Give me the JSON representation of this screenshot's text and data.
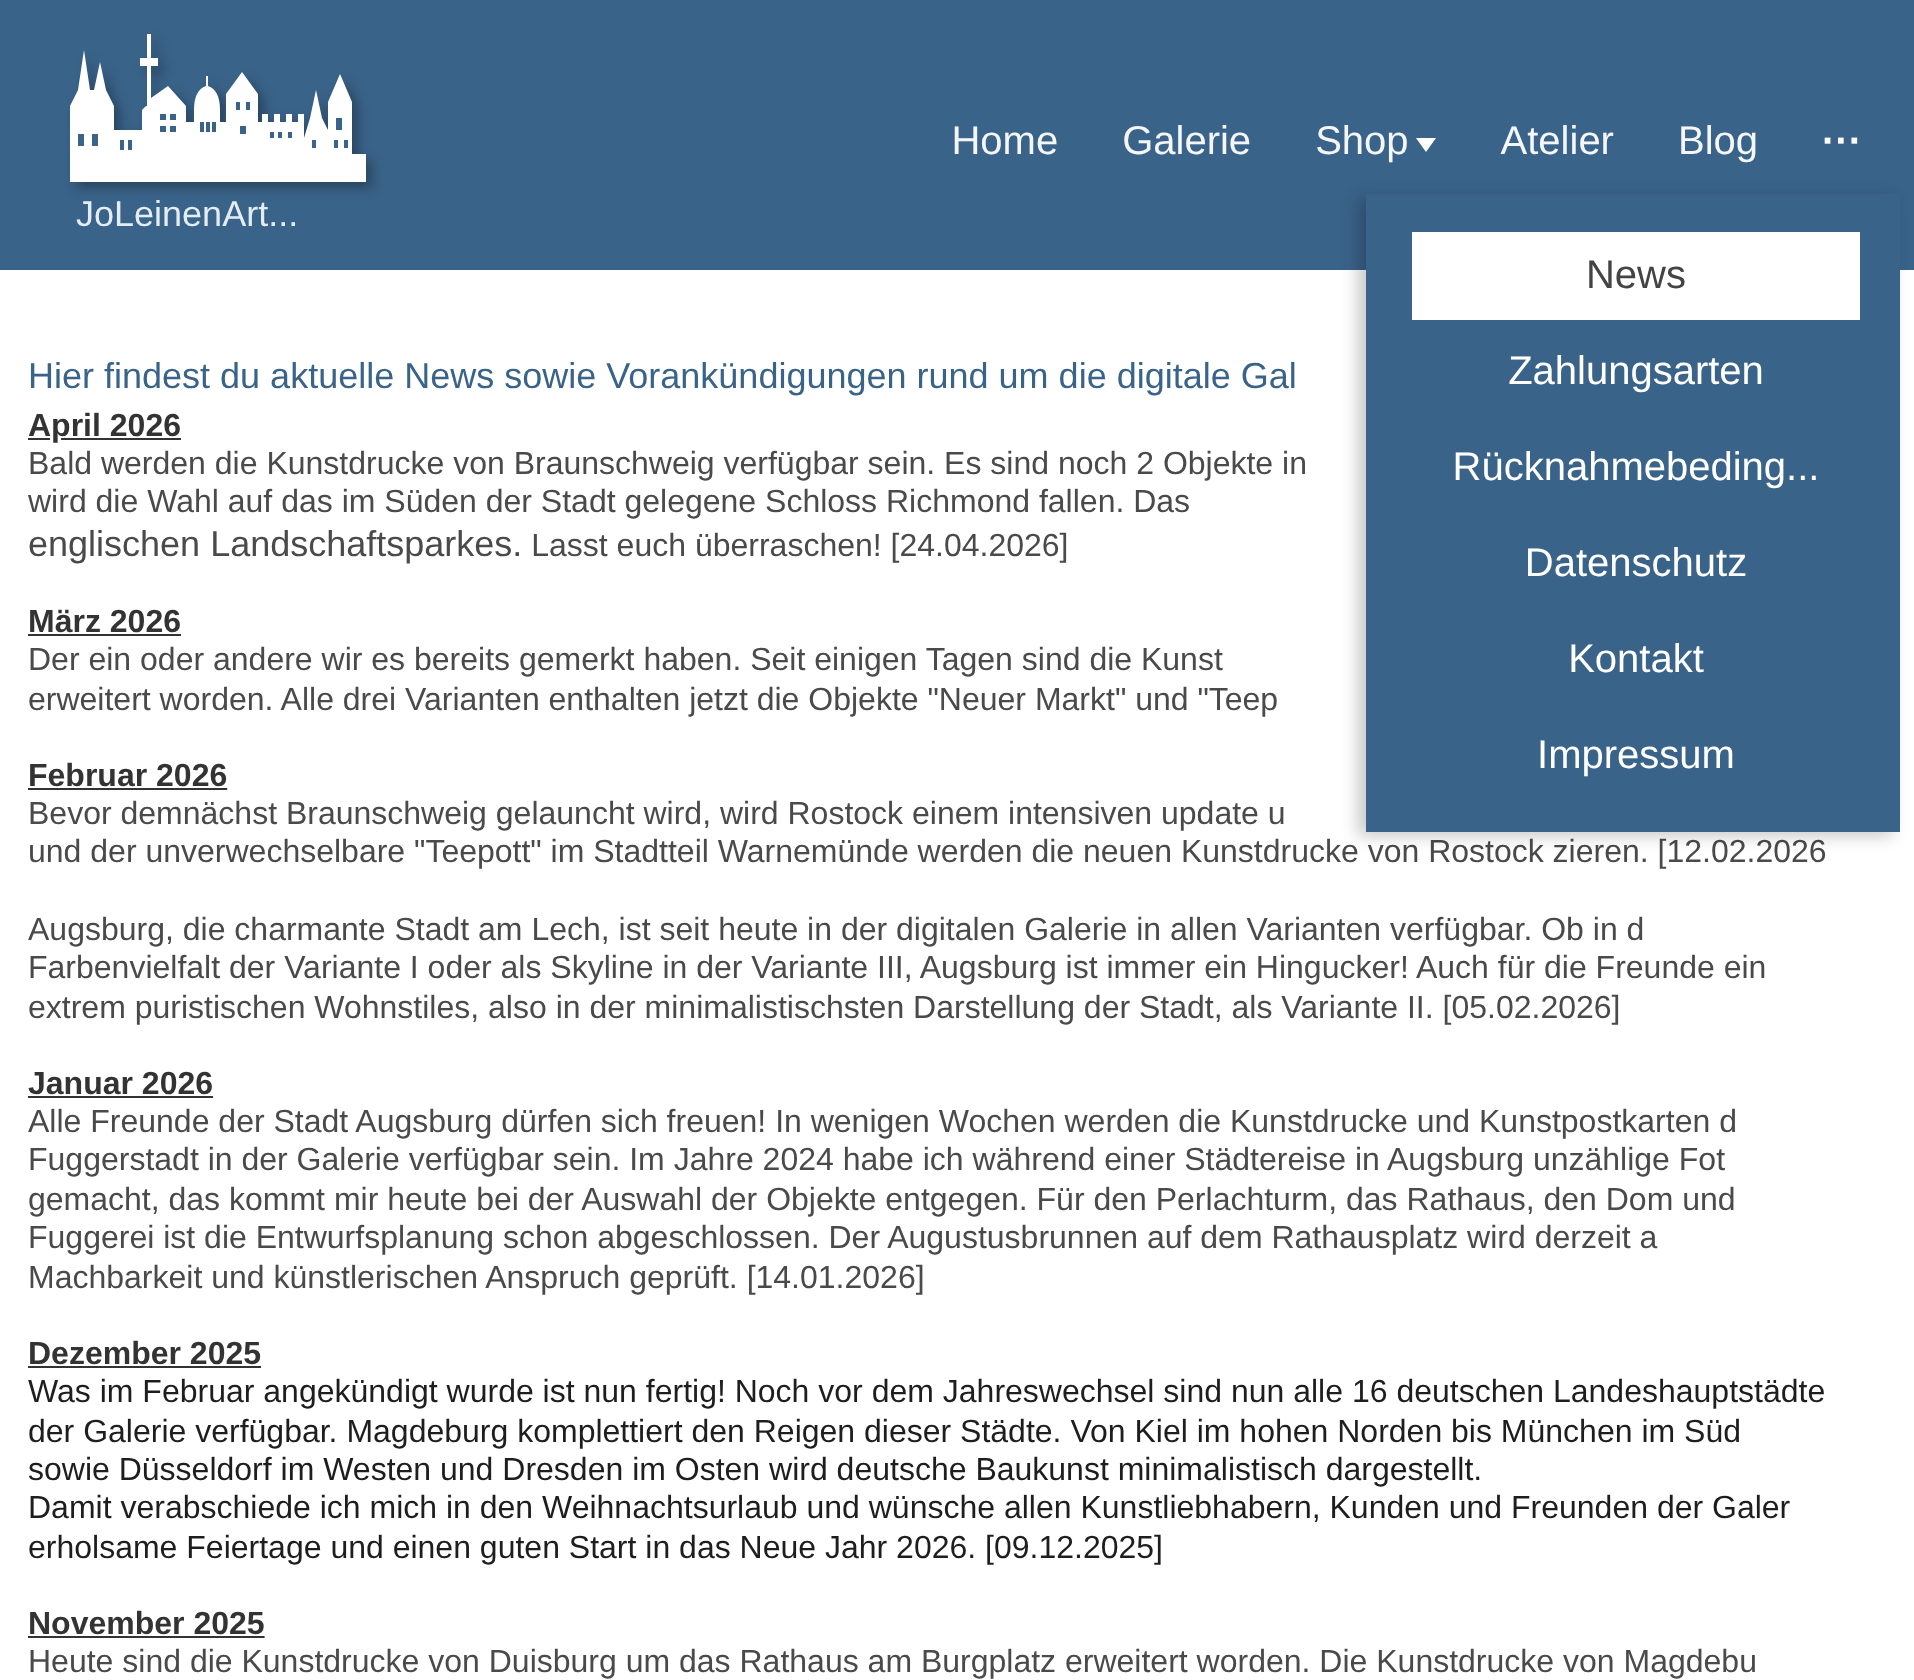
{
  "header": {
    "logo_text": "JoLeinenArt...",
    "nav": [
      {
        "label": "Home",
        "kind": "link"
      },
      {
        "label": "Galerie",
        "kind": "link"
      },
      {
        "label": "Shop",
        "kind": "dropdown",
        "expanded": false
      },
      {
        "label": "Atelier",
        "kind": "link"
      },
      {
        "label": "Blog",
        "kind": "link"
      },
      {
        "label": "···",
        "kind": "more",
        "expanded": true,
        "items": [
          {
            "label": "News",
            "selected": true
          },
          {
            "label": "Zahlungsarten",
            "selected": false
          },
          {
            "label": "Rücknahmebeding...",
            "selected": false
          },
          {
            "label": "Datenschutz",
            "selected": false
          },
          {
            "label": "Kontakt",
            "selected": false
          },
          {
            "label": "Impressum",
            "selected": false
          }
        ]
      }
    ]
  },
  "content": {
    "intro": "Hier findest du aktuelle News sowie Vorankündigungen rund um die digitale Gal",
    "sections": [
      {
        "heading": "April 2026",
        "paragraphs": [
          {
            "emphasized": false,
            "lines": [
              "Bald werden die Kunstdrucke von Braunschweig verfügbar sein. Es sind noch 2 Objekte in",
              "wird die Wahl auf das im Süden der Stadt gelegene Schloss Richmond fallen. Das",
              {
                "parts": [
                  {
                    "text": "englischen Landschaftsparkes.",
                    "kind": "large"
                  },
                  {
                    "text": " Lasst euch überraschen! [24.04.2026]",
                    "kind": "normal"
                  }
                ]
              }
            ]
          }
        ]
      },
      {
        "heading": "März 2026",
        "paragraphs": [
          {
            "emphasized": false,
            "lines": [
              "Der ein oder andere wir es bereits gemerkt haben. Seit einigen Tagen sind die Kunst",
              "erweitert worden. Alle drei Varianten enthalten jetzt die Objekte \"Neuer Markt\" und \"Teep"
            ]
          }
        ]
      },
      {
        "heading": "Februar 2026",
        "paragraphs": [
          {
            "emphasized": false,
            "lines": [
              "Bevor demnächst Braunschweig gelauncht wird, wird Rostock einem intensiven update u",
              "und der unverwechselbare \"Teepott\" im Stadtteil Warnemünde werden die neuen Kunstdrucke von Rostock zieren. [12.02.2026"
            ]
          },
          {
            "emphasized": false,
            "lines": [
              "Augsburg, die charmante Stadt am Lech, ist seit heute in der digitalen Galerie in allen Varianten verfügbar. Ob in d",
              "Farbenvielfalt der Variante I oder als Skyline in der Variante III, Augsburg ist immer ein Hingucker! Auch für die Freunde ein",
              "extrem puristischen Wohnstiles, also in der minimalistischsten Darstellung der Stadt, als Variante II. [05.02.2026]"
            ]
          }
        ]
      },
      {
        "heading": "Januar 2026",
        "paragraphs": [
          {
            "emphasized": false,
            "lines": [
              "Alle Freunde der Stadt Augsburg dürfen sich freuen! In wenigen Wochen werden die Kunstdrucke und Kunstpostkarten d",
              "Fuggerstadt in der Galerie verfügbar sein. Im Jahre 2024 habe ich während einer Städtereise in Augsburg unzählige Fot",
              "gemacht, das kommt mir heute bei der Auswahl der Objekte entgegen. Für den Perlachturm, das Rathaus, den Dom und",
              "Fuggerei ist die Entwurfsplanung schon abgeschlossen. Der Augustusbrunnen auf dem Rathausplatz wird derzeit a",
              "Machbarkeit und künstlerischen Anspruch geprüft. [14.01.2026]"
            ]
          }
        ]
      },
      {
        "heading": "Dezember 2025",
        "paragraphs": [
          {
            "emphasized": true,
            "lines": [
              "Was im Februar angekündigt wurde ist nun fertig! Noch vor dem Jahreswechsel sind nun alle 16 deutschen Landeshauptstädte",
              "der Galerie verfügbar. Magdeburg komplettiert den Reigen dieser Städte. Von Kiel im hohen Norden bis München im Süd",
              "sowie Düsseldorf im Westen und Dresden im Osten wird deutsche Baukunst minimalistisch dargestellt.",
              "Damit verabschiede ich mich in den Weihnachtsurlaub und wünsche allen Kunstliebhabern, Kunden und Freunden der Galer",
              "erholsame Feiertage und einen guten Start in das Neue Jahr 2026. [09.12.2025]"
            ]
          }
        ]
      },
      {
        "heading": "November 2025",
        "paragraphs": [
          {
            "emphasized": false,
            "lines": [
              "Heute sind die Kunstdrucke von Duisburg um das Rathaus am Burgplatz erweitert worden. Die Kunstdrucke von Magdebu"
            ]
          }
        ]
      }
    ]
  }
}
